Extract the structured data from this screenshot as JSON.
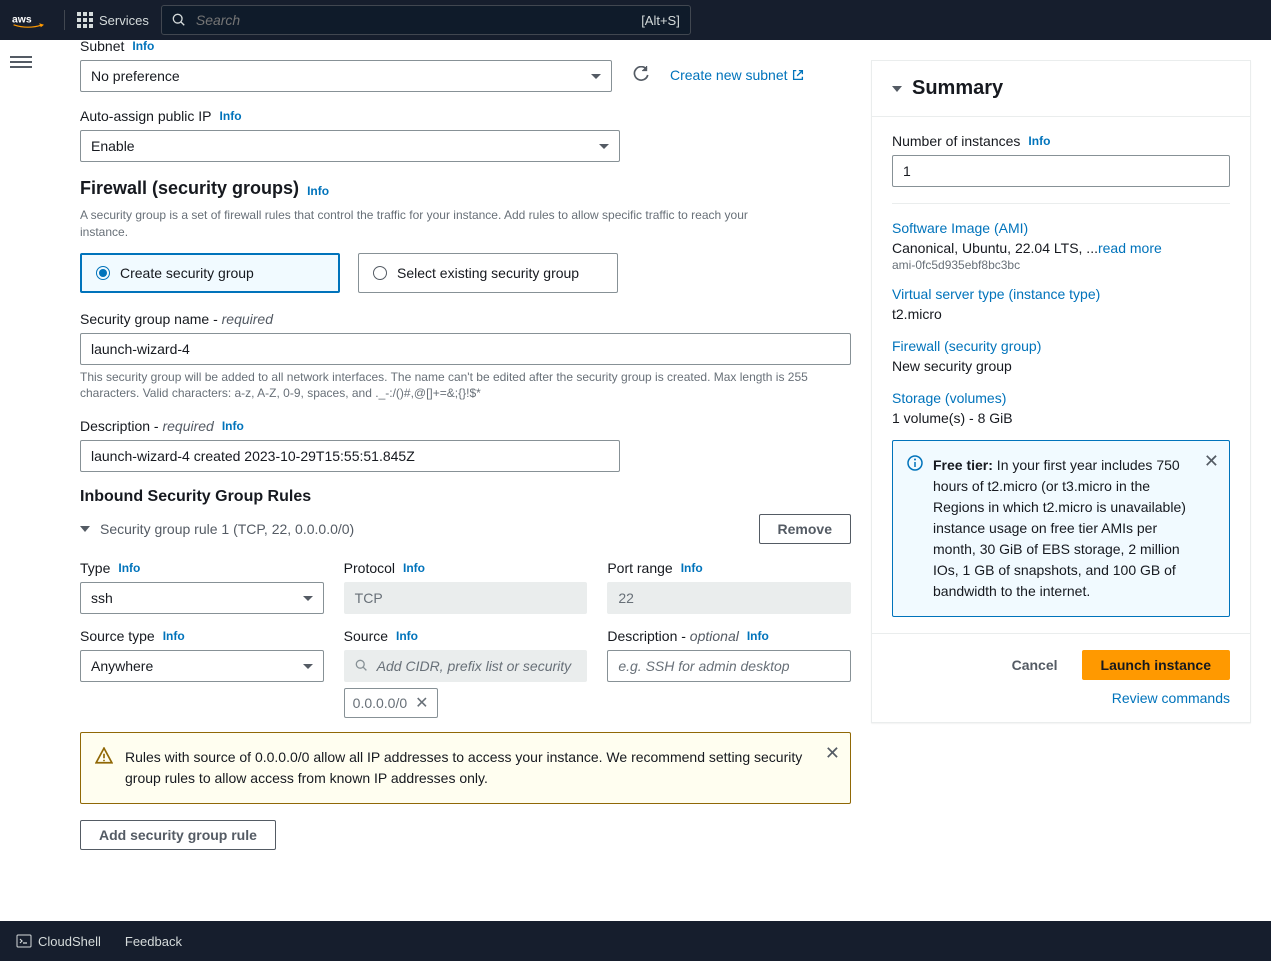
{
  "topnav": {
    "services": "Services",
    "search_placeholder": "Search",
    "search_shortcut": "[Alt+S]"
  },
  "subnet": {
    "label": "Subnet",
    "info": "Info",
    "value": "No preference",
    "create_link": "Create new subnet"
  },
  "auto_ip": {
    "label": "Auto-assign public IP",
    "info": "Info",
    "value": "Enable"
  },
  "firewall": {
    "heading": "Firewall (security groups)",
    "info": "Info",
    "desc": "A security group is a set of firewall rules that control the traffic for your instance. Add rules to allow specific traffic to reach your instance.",
    "radio_create": "Create security group",
    "radio_select": "Select existing security group"
  },
  "sg_name": {
    "label": "Security group name - ",
    "req": "required",
    "value": "launch-wizard-4",
    "help": "This security group will be added to all network interfaces. The name can't be edited after the security group is created. Max length is 255 characters. Valid characters: a-z, A-Z, 0-9, spaces, and ._-:/()#,@[]+=&;{}!$*"
  },
  "sg_desc": {
    "label": "Description - ",
    "req": "required",
    "info": "Info",
    "value": "launch-wizard-4 created 2023-10-29T15:55:51.845Z"
  },
  "inbound": {
    "heading": "Inbound Security Group Rules",
    "rule_title": "Security group rule 1 (TCP, 22, 0.0.0.0/0)",
    "remove": "Remove",
    "type_label": "Type",
    "type_value": "ssh",
    "protocol_label": "Protocol",
    "protocol_value": "TCP",
    "port_label": "Port range",
    "port_value": "22",
    "source_type_label": "Source type",
    "source_type_value": "Anywhere",
    "source_label": "Source",
    "source_placeholder": "Add CIDR, prefix list or security",
    "source_chip": "0.0.0.0/0",
    "desc_label": "Description - ",
    "desc_opt": "optional",
    "desc_placeholder": "e.g. SSH for admin desktop",
    "info": "Info"
  },
  "warning": "Rules with source of 0.0.0.0/0 allow all IP addresses to access your instance. We recommend setting security group rules to allow access from known IP addresses only.",
  "add_rule_btn": "Add security group rule",
  "summary": {
    "title": "Summary",
    "num_label": "Number of instances",
    "num_value": "1",
    "info": "Info",
    "ami_label": "Software Image (AMI)",
    "ami_text": "Canonical, Ubuntu, 22.04 LTS, ...",
    "read_more": "read more",
    "ami_id": "ami-0fc5d935ebf8bc3bc",
    "type_label": "Virtual server type (instance type)",
    "type_value": "t2.micro",
    "fw_label": "Firewall (security group)",
    "fw_value": "New security group",
    "storage_label": "Storage (volumes)",
    "storage_value": "1 volume(s) - 8 GiB",
    "free_tier_bold": "Free tier:",
    "free_tier_text": " In your first year includes 750 hours of t2.micro (or t3.micro in the Regions in which t2.micro is unavailable) instance usage on free tier AMIs per month, 30 GiB of EBS storage, 2 million IOs, 1 GB of snapshots, and 100 GB of bandwidth to the internet.",
    "cancel": "Cancel",
    "launch": "Launch instance",
    "review": "Review commands"
  },
  "bottombar": {
    "cloudshell": "CloudShell",
    "feedback": "Feedback"
  }
}
